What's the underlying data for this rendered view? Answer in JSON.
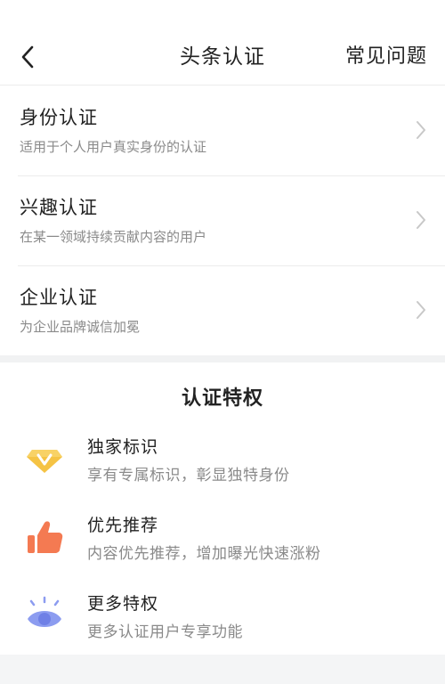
{
  "header": {
    "title": "头条认证",
    "faq_label": "常见问题"
  },
  "certifications": [
    {
      "title": "身份认证",
      "subtitle": "适用于个人用户真实身份的认证"
    },
    {
      "title": "兴趣认证",
      "subtitle": "在某一领域持续贡献内容的用户"
    },
    {
      "title": "企业认证",
      "subtitle": "为企业品牌诚信加冕"
    }
  ],
  "privileges": {
    "title": "认证特权",
    "items": [
      {
        "icon": "diamond-v-icon",
        "title": "独家标识",
        "subtitle": "享有专属标识，彰显独特身份"
      },
      {
        "icon": "thumbs-up-icon",
        "title": "优先推荐",
        "subtitle": "内容优先推荐，增加曝光快速涨粉"
      },
      {
        "icon": "eye-icon",
        "title": "更多特权",
        "subtitle": "更多认证用户专享功能"
      }
    ]
  },
  "colors": {
    "diamond": "#f5c344",
    "thumb": "#f47a52",
    "eye": "#8c9cf0"
  }
}
